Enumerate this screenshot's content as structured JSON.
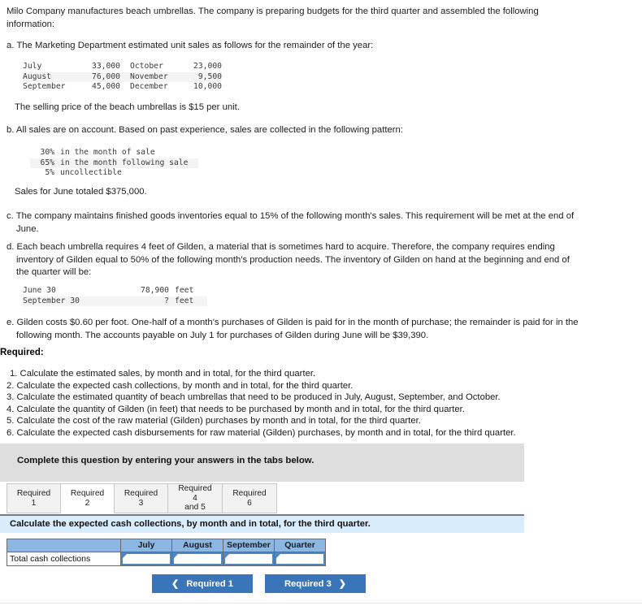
{
  "problem": {
    "intro": "Milo Company manufactures beach umbrellas. The company is preparing budgets for the third quarter and assembled the following information:",
    "item_a": "a. The Marketing Department estimated unit sales as follows for the remainder of the year:",
    "sales_table": [
      {
        "month1": "July",
        "units1": "33,000",
        "month2": "October",
        "units2": "23,000"
      },
      {
        "month1": "August",
        "units1": "76,000",
        "month2": "November",
        "units2": "9,500"
      },
      {
        "month1": "September",
        "units1": "45,000",
        "month2": "December",
        "units2": "10,000"
      }
    ],
    "selling_price": "The selling price of the beach umbrellas is $15 per unit.",
    "item_b": "b. All sales are on account. Based on past experience, sales are collected in the following pattern:",
    "collection_pattern": [
      {
        "pct": "30%",
        "desc": "in the month of sale"
      },
      {
        "pct": "65%",
        "desc": "in the month following sale"
      },
      {
        "pct": "5%",
        "desc": "uncollectible"
      }
    ],
    "june_sales": "Sales for June totaled $375,000.",
    "item_c": "c. The company maintains finished goods inventories equal to 15% of the following month's sales. This requirement will be met at the end of June.",
    "item_d": "d. Each beach umbrella requires 4 feet of Gilden, a material that is sometimes hard to acquire. Therefore, the company requires ending inventory of Gilden equal to 50% of the following month's production needs. The inventory of Gilden on hand at the beginning and end of the quarter will be:",
    "gilden_table": [
      {
        "label": "June 30",
        "value": "78,900",
        "unit": "feet"
      },
      {
        "label": "September 30",
        "value": "?",
        "unit": "feet"
      }
    ],
    "item_e": "e. Gilden costs $0.60 per foot. One-half of a month's purchases of Gilden is paid for in the month of purchase; the remainder is paid for in the following month. The accounts payable on July 1 for purchases of Gilden during June will be $39,390."
  },
  "required": {
    "heading": "Required:",
    "items": [
      "1. Calculate the estimated sales, by month and in total, for the third quarter.",
      "2. Calculate the expected cash collections, by month and in total, for the third quarter.",
      "3. Calculate the estimated quantity of beach umbrellas that need to be produced in July, August, September, and October.",
      "4. Calculate the quantity of Gilden (in feet) that needs to be purchased by month and in total, for the third quarter.",
      "5. Calculate the cost of the raw material (Gilden) purchases by month and in total, for the third quarter.",
      "6. Calculate the expected cash disbursements for raw material (Gilden) purchases, by month and in total, for the third quarter."
    ]
  },
  "answer_area": {
    "complete_banner": "Complete this question by entering your answers in the tabs below.",
    "tabs": [
      {
        "label": "Required 1",
        "active": false
      },
      {
        "label": "Required 2",
        "active": true
      },
      {
        "label": "Required 3",
        "active": false
      },
      {
        "label": "Required 4 and 5",
        "active": false
      },
      {
        "label": "Required 6",
        "active": false
      }
    ],
    "tab_labels": {
      "t1": "Required 1",
      "t2": "Required 2",
      "t3": "Required 3",
      "t4_line1": "Required 4",
      "t4_line2": "and 5",
      "t5": "Required 6"
    },
    "question_prompt": "Calculate the expected cash collections, by month and in total, for the third quarter.",
    "table": {
      "corner_header": "",
      "columns": [
        "July",
        "August",
        "September",
        "Quarter"
      ],
      "rows": [
        {
          "label": "Total cash collections",
          "values": [
            "",
            "",
            "",
            ""
          ]
        }
      ]
    },
    "nav": {
      "prev_label": "Required 1",
      "next_label": "Required 3",
      "prev_chevron": "❮",
      "next_chevron": "❯"
    }
  },
  "colors": {
    "banner_gray": "#dedede",
    "strip_blue": "#d9ecfb",
    "table_header_blue": "#8cb7e2",
    "button_blue": "#3a75ba",
    "input_border_blue": "#4f87c4"
  }
}
